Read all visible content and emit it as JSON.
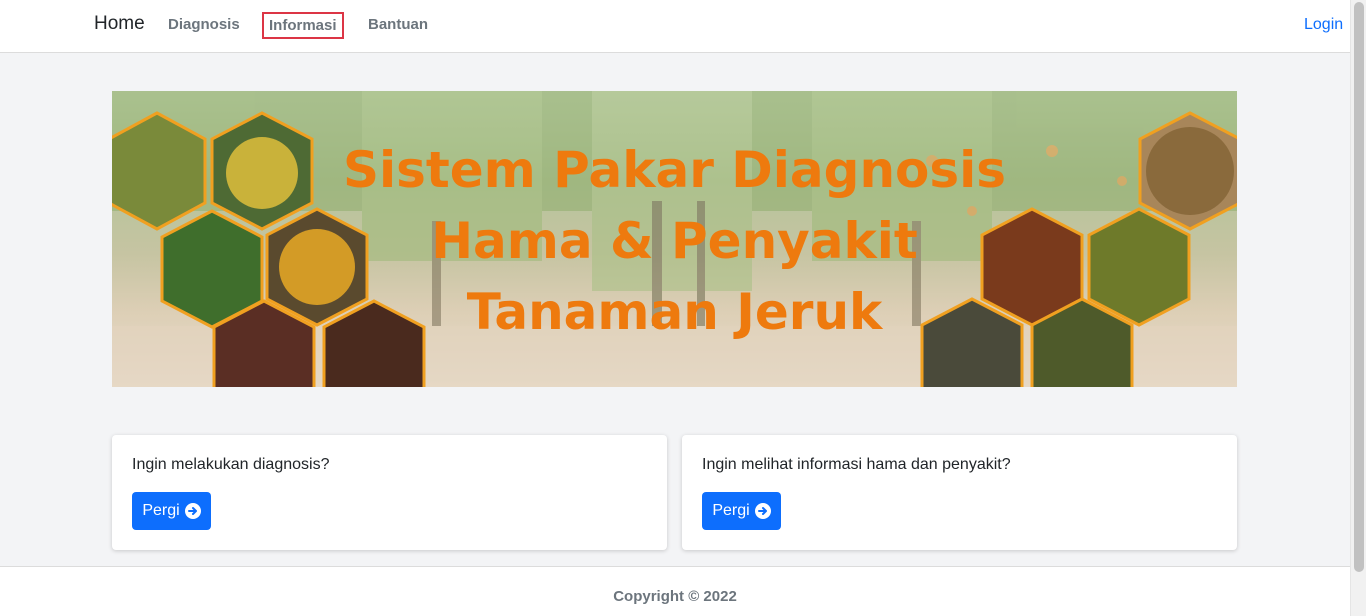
{
  "navbar": {
    "brand": "Home",
    "items": [
      {
        "label": "Diagnosis"
      },
      {
        "label": "Informasi"
      },
      {
        "label": "Bantuan"
      }
    ],
    "login": "Login"
  },
  "banner": {
    "title_lines": [
      "Sistem Pakar Diagnosis",
      "Hama & Penyakit",
      "Tanaman Jeruk"
    ],
    "title_color": "#ee7a0e"
  },
  "cards": [
    {
      "text": "Ingin melakukan diagnosis?",
      "button": "Pergi"
    },
    {
      "text": "Ingin melihat informasi hama dan penyakit?",
      "button": "Pergi"
    }
  ],
  "footer": {
    "copyright": "Copyright © 2022"
  },
  "colors": {
    "primary": "#0d6efd",
    "highlight_border": "#dc3545",
    "hex_border": "#f0a020"
  },
  "icons": [
    "arrow-circle-right-icon"
  ]
}
